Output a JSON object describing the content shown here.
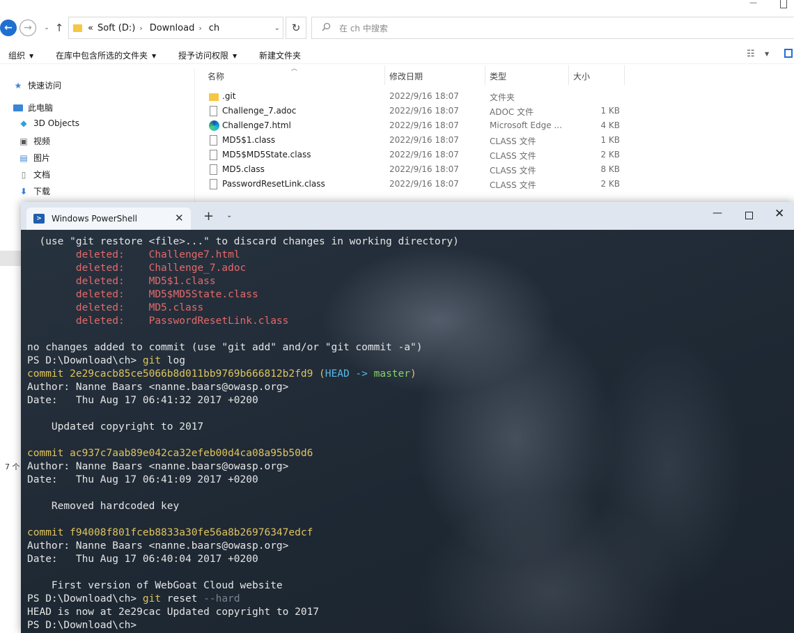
{
  "explorer": {
    "nav": {
      "back_glyph": "←",
      "forward_glyph": "→",
      "recent_glyph": "⌄",
      "up_glyph": "↑"
    },
    "address": {
      "prefix": "«",
      "crumbs": [
        "Soft (D:)",
        "Download",
        "ch"
      ],
      "separator": "›",
      "dropdown_glyph": "⌄",
      "refresh_glyph": "↻"
    },
    "search": {
      "placeholder": "在 ch 中搜索",
      "icon": "search-icon"
    },
    "commands": [
      {
        "label": "组织"
      },
      {
        "label": "在库中包含所选的文件夹"
      },
      {
        "label": "授予访问权限"
      },
      {
        "label": "新建文件夹"
      }
    ],
    "nav_pane": [
      {
        "label": "快速访问",
        "icon": "star-icon",
        "color": "#3a86d6"
      },
      {
        "label": "此电脑",
        "icon": "computer-icon",
        "color": "#3a86d6"
      },
      {
        "label": "3D Objects",
        "icon": "cube-icon",
        "color": "#2aa3d8"
      },
      {
        "label": "视频",
        "icon": "video-icon",
        "color": "#555555"
      },
      {
        "label": "图片",
        "icon": "picture-icon",
        "color": "#3a86d6"
      },
      {
        "label": "文档",
        "icon": "document-icon",
        "color": "#777777"
      },
      {
        "label": "下载",
        "icon": "download-icon",
        "color": "#2f7fd6"
      }
    ],
    "status_count": "7 个",
    "columns": {
      "name": "名称",
      "date": "修改日期",
      "type": "类型",
      "size": "大小"
    },
    "files": [
      {
        "name": ".git",
        "date": "2022/9/16 18:07",
        "type": "文件夹",
        "size": "",
        "icon": "folder-icon"
      },
      {
        "name": "Challenge_7.adoc",
        "date": "2022/9/16 18:07",
        "type": "ADOC 文件",
        "size": "1 KB",
        "icon": "file-icon"
      },
      {
        "name": "Challenge7.html",
        "date": "2022/9/16 18:07",
        "type": "Microsoft Edge ...",
        "size": "4 KB",
        "icon": "edge-icon"
      },
      {
        "name": "MD5$1.class",
        "date": "2022/9/16 18:07",
        "type": "CLASS 文件",
        "size": "1 KB",
        "icon": "file-icon"
      },
      {
        "name": "MD5$MD5State.class",
        "date": "2022/9/16 18:07",
        "type": "CLASS 文件",
        "size": "2 KB",
        "icon": "file-icon"
      },
      {
        "name": "MD5.class",
        "date": "2022/9/16 18:07",
        "type": "CLASS 文件",
        "size": "8 KB",
        "icon": "file-icon"
      },
      {
        "name": "PasswordResetLink.class",
        "date": "2022/9/16 18:07",
        "type": "CLASS 文件",
        "size": "2 KB",
        "icon": "file-icon"
      }
    ]
  },
  "terminal": {
    "tab_title": "Windows PowerShell",
    "tab_icon_glyph": ">",
    "close_glyph": "✕",
    "new_tab_glyph": "+",
    "dropdown_glyph": "⌄",
    "minimize_glyph": "—",
    "colors": {
      "red": "#e36a6a",
      "yellow": "#e0c45c",
      "cyan": "#5cb8e6",
      "green": "#86d36a",
      "text": "#e6e6e6"
    },
    "lines": [
      [
        {
          "t": "  (use \"git restore <file>...\" to discard changes in working directory)"
        }
      ],
      [
        {
          "t": "        "
        },
        {
          "t": "deleted:    Challenge7.html",
          "c": "red"
        }
      ],
      [
        {
          "t": "        "
        },
        {
          "t": "deleted:    Challenge_7.adoc",
          "c": "red"
        }
      ],
      [
        {
          "t": "        "
        },
        {
          "t": "deleted:    MD5$1.class",
          "c": "red"
        }
      ],
      [
        {
          "t": "        "
        },
        {
          "t": "deleted:    MD5$MD5State.class",
          "c": "red"
        }
      ],
      [
        {
          "t": "        "
        },
        {
          "t": "deleted:    MD5.class",
          "c": "red"
        }
      ],
      [
        {
          "t": "        "
        },
        {
          "t": "deleted:    PasswordResetLink.class",
          "c": "red"
        }
      ],
      [
        {
          "t": ""
        }
      ],
      [
        {
          "t": "no changes added to commit (use \"git add\" and/or \"git commit -a\")"
        }
      ],
      [
        {
          "t": "PS D:\\Download\\ch> "
        },
        {
          "t": "git",
          "c": "yel"
        },
        {
          "t": " log"
        }
      ],
      [
        {
          "t": "commit 2e29cacb85ce5066b8d011bb9769b666812b2fd9 (",
          "c": "yel"
        },
        {
          "t": "HEAD -> ",
          "c": "cyan"
        },
        {
          "t": "master",
          "c": "grn"
        },
        {
          "t": ")",
          "c": "yel"
        }
      ],
      [
        {
          "t": "Author: Nanne Baars <nanne.baars@owasp.org>"
        }
      ],
      [
        {
          "t": "Date:   Thu Aug 17 06:41:32 2017 +0200"
        }
      ],
      [
        {
          "t": ""
        }
      ],
      [
        {
          "t": "    Updated copyright to 2017"
        }
      ],
      [
        {
          "t": ""
        }
      ],
      [
        {
          "t": "commit ac937c7aab89e042ca32efeb00d4ca08a95b50d6",
          "c": "yel"
        }
      ],
      [
        {
          "t": "Author: Nanne Baars <nanne.baars@owasp.org>"
        }
      ],
      [
        {
          "t": "Date:   Thu Aug 17 06:41:09 2017 +0200"
        }
      ],
      [
        {
          "t": ""
        }
      ],
      [
        {
          "t": "    Removed hardcoded key"
        }
      ],
      [
        {
          "t": ""
        }
      ],
      [
        {
          "t": "commit f94008f801fceb8833a30fe56a8b26976347edcf",
          "c": "yel"
        }
      ],
      [
        {
          "t": "Author: Nanne Baars <nanne.baars@owasp.org>"
        }
      ],
      [
        {
          "t": "Date:   Thu Aug 17 06:40:04 2017 +0200"
        }
      ],
      [
        {
          "t": ""
        }
      ],
      [
        {
          "t": "    First version of WebGoat Cloud website"
        }
      ],
      [
        {
          "t": "PS D:\\Download\\ch> "
        },
        {
          "t": "git",
          "c": "yel"
        },
        {
          "t": " reset "
        },
        {
          "t": "--hard",
          "c": "gray"
        }
      ],
      [
        {
          "t": "HEAD is now at 2e29cac Updated copyright to 2017"
        }
      ],
      [
        {
          "t": "PS D:\\Download\\ch>"
        }
      ]
    ]
  }
}
